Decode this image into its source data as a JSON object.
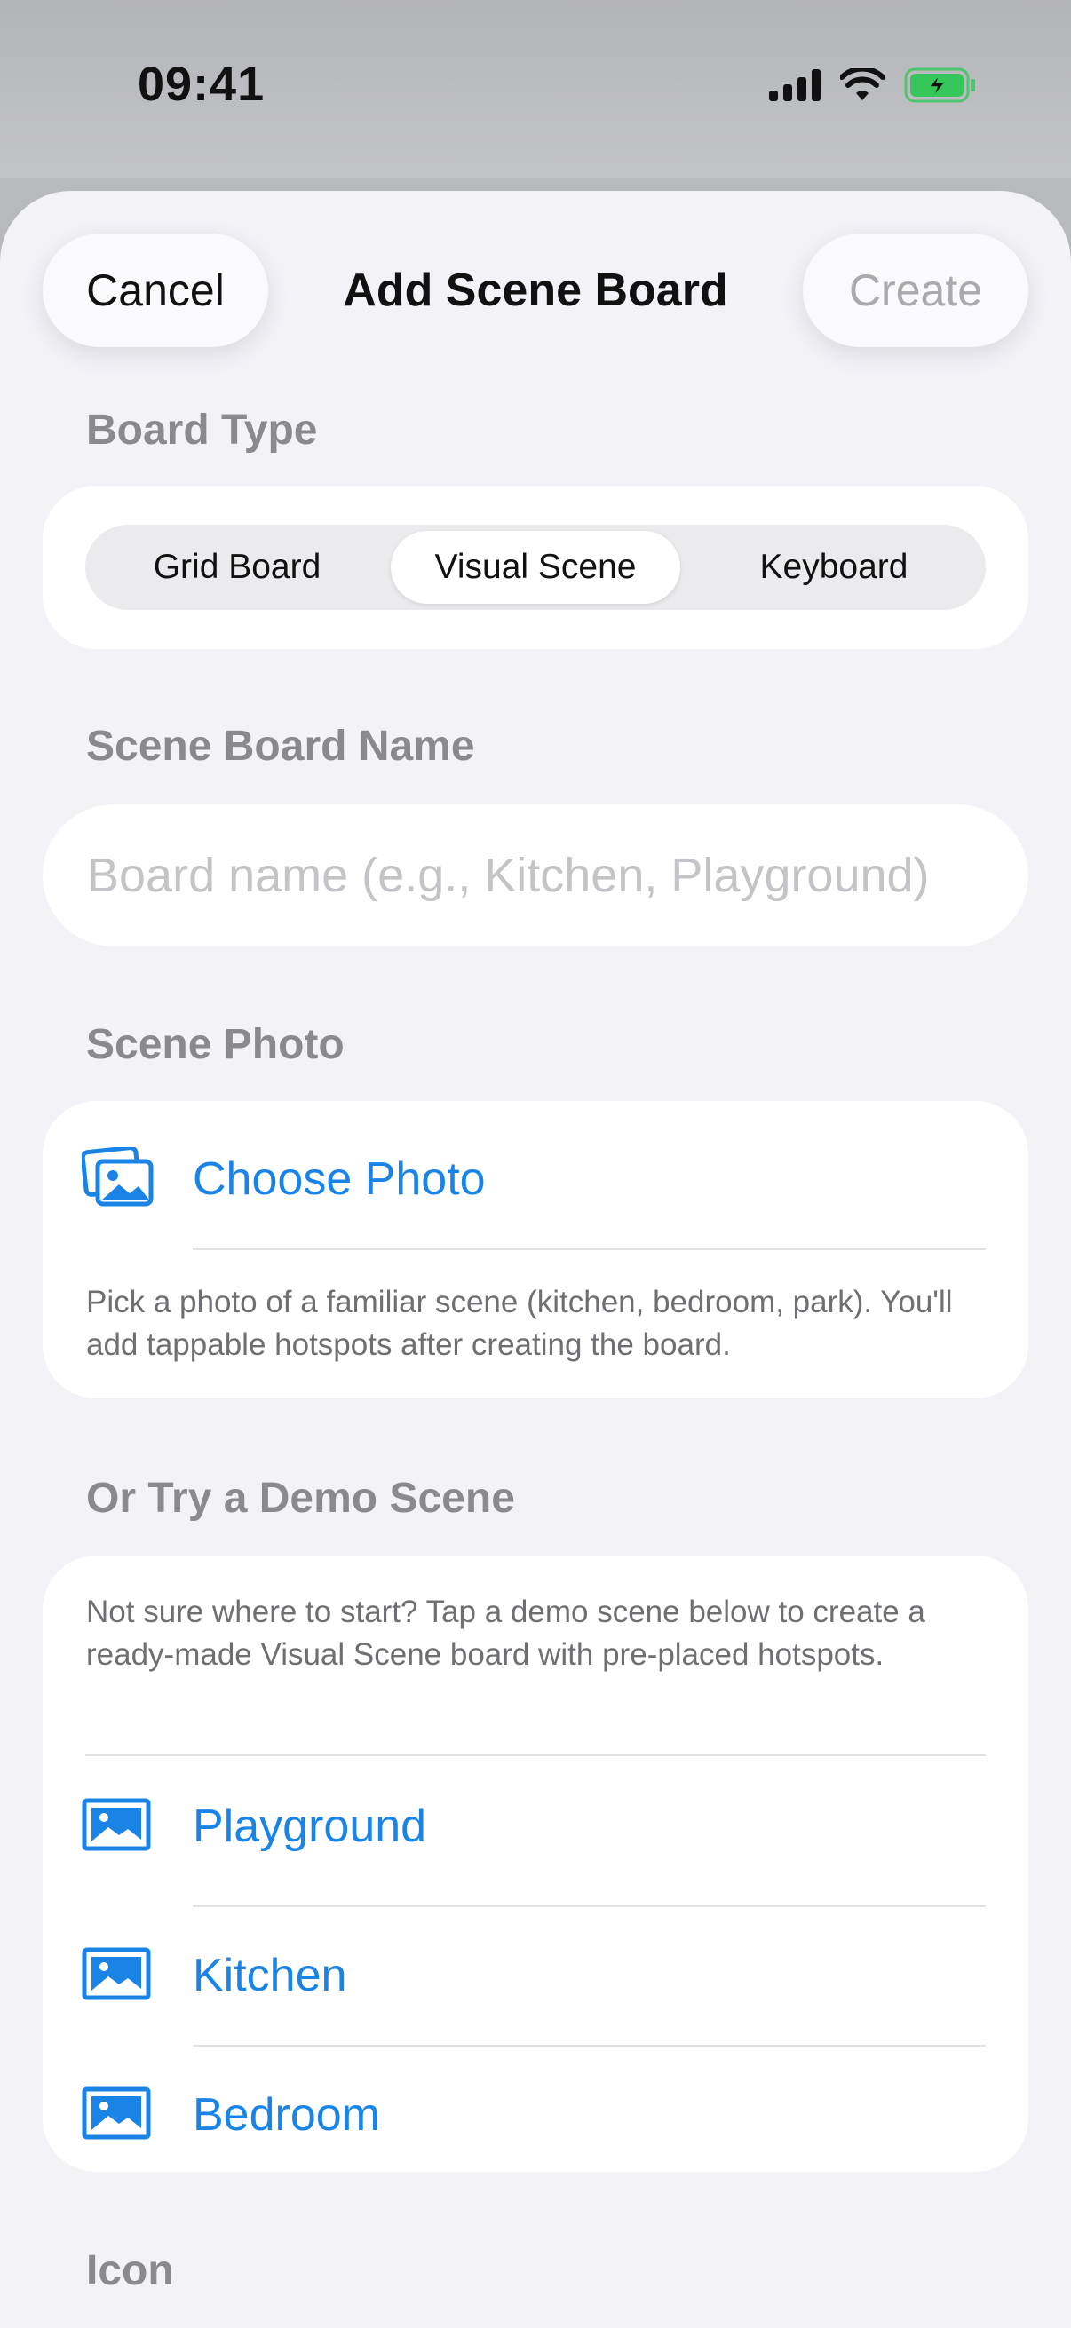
{
  "status_bar": {
    "time": "09:41",
    "icons": [
      "cellular-signal-icon",
      "wifi-icon",
      "battery-charging-icon"
    ]
  },
  "nav": {
    "cancel_label": "Cancel",
    "title": "Add Scene Board",
    "create_label": "Create"
  },
  "board_type": {
    "section_label": "Board Type",
    "options": [
      "Grid Board",
      "Visual Scene",
      "Keyboard"
    ],
    "selected": "Visual Scene"
  },
  "scene_name": {
    "section_label": "Scene Board Name",
    "value": "",
    "placeholder": "Board name (e.g., Kitchen, Playground)"
  },
  "scene_photo": {
    "section_label": "Scene Photo",
    "choose_label": "Choose Photo",
    "icon": "photo-stack-icon",
    "help": "Pick a photo of a familiar scene (kitchen, bedroom, park). You'll add tappable hotspots after creating the board."
  },
  "demo": {
    "section_label": "Or Try a Demo Scene",
    "help": "Not sure where to start? Tap a demo scene below to create a ready-made Visual Scene board with pre-placed hotspots.",
    "items": [
      {
        "label": "Playground",
        "icon": "photo-icon"
      },
      {
        "label": "Kitchen",
        "icon": "photo-icon"
      },
      {
        "label": "Bedroom",
        "icon": "photo-icon"
      }
    ]
  },
  "icon_section": {
    "section_label": "Icon"
  },
  "colors": {
    "accent": "#1a84e6",
    "battery": "#35c759",
    "sheet_background": "#f2f2f7"
  }
}
